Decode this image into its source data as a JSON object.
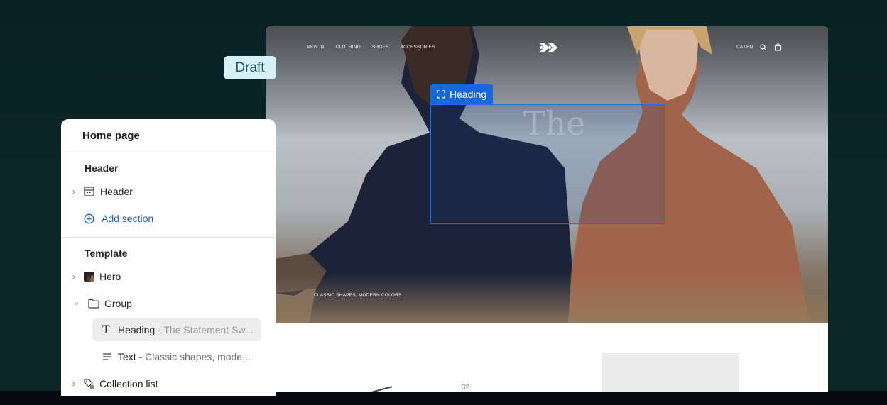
{
  "badge": {
    "draft": "Draft"
  },
  "store": {
    "nav": [
      "NEW IN",
      "CLOTHING",
      "SHOES",
      "ACCESSORIES"
    ],
    "locale": "CA / EN",
    "hero_caption": "CLASSIC SHAPES, MODERN COLORS",
    "hero_heading_ghost": "The",
    "page_number": "32"
  },
  "selection": {
    "label": "Heading"
  },
  "editor": {
    "page_title": "Home page",
    "header_section_label": "Header",
    "header_item": "Header",
    "add_section": "Add section",
    "template_label": "Template",
    "items": {
      "hero": "Hero",
      "group": "Group",
      "heading_name": "Heading",
      "heading_sep": " - ",
      "heading_preview": "The Statement Sw...",
      "text_name": "Text",
      "text_sep": " - ",
      "text_preview": "Classic shapes, mode...",
      "collection": "Collection list"
    }
  },
  "colors": {
    "accent": "#1868dc",
    "draft_bg": "#d7f2f6",
    "background": "#0b2628"
  }
}
